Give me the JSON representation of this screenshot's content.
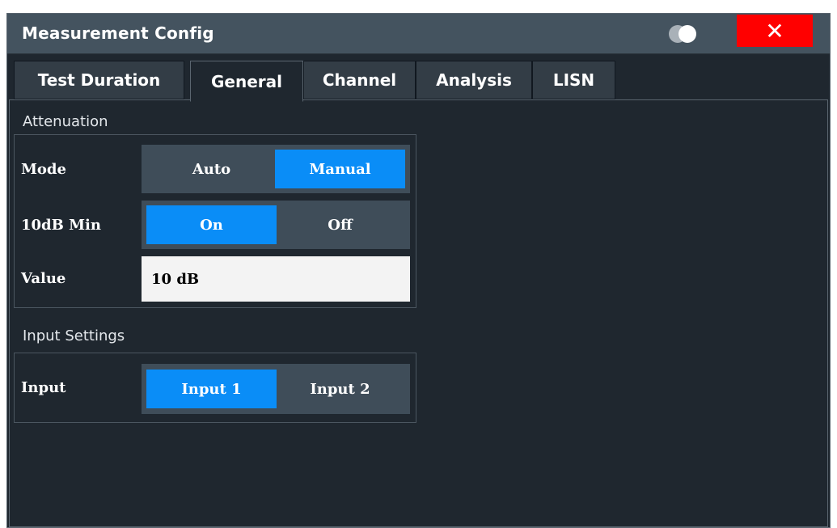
{
  "dialog": {
    "title": "Measurement Config",
    "close_label": "✕",
    "colors": {
      "accent": "#0a8df7",
      "close": "#ff0000",
      "titlebar": "#44535f",
      "background": "#1f272f"
    }
  },
  "tabs": [
    {
      "label": "Test Duration",
      "active": false
    },
    {
      "label": "General",
      "active": true
    },
    {
      "label": "Channel",
      "active": false
    },
    {
      "label": "Analysis",
      "active": false
    },
    {
      "label": "LISN",
      "active": false
    }
  ],
  "attenuation": {
    "group_label": "Attenuation",
    "mode": {
      "label": "Mode",
      "options": [
        "Auto",
        "Manual"
      ],
      "selected": "Manual"
    },
    "min10db": {
      "label": "10dB Min",
      "options": [
        "On",
        "Off"
      ],
      "selected": "On"
    },
    "value": {
      "label": "Value",
      "value": "10 dB"
    }
  },
  "input_settings": {
    "group_label": "Input Settings",
    "input": {
      "label": "Input",
      "options": [
        "Input 1",
        "Input 2"
      ],
      "selected": "Input 1"
    }
  }
}
